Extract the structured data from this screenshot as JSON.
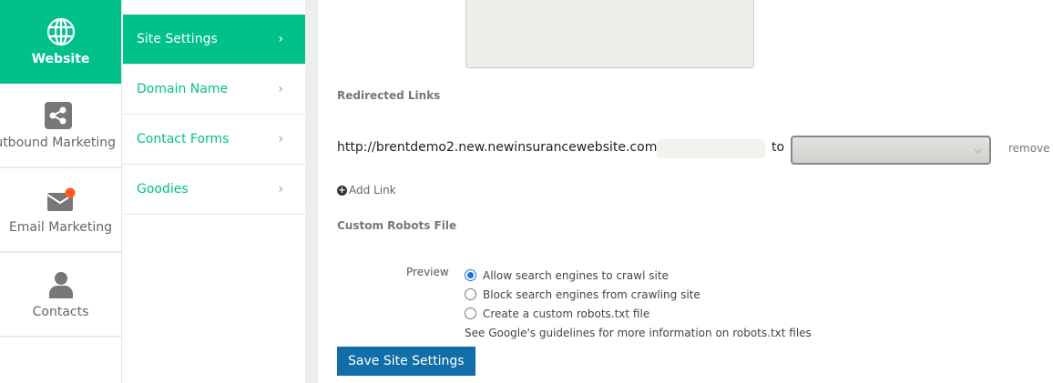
{
  "rail": [
    {
      "label": "Website",
      "icon": "globe-icon"
    },
    {
      "label": "Outbound Marketing",
      "icon": "share-icon"
    },
    {
      "label": "Email Marketing",
      "icon": "envelope-icon"
    },
    {
      "label": "Contacts",
      "icon": "user-icon"
    }
  ],
  "submenu": [
    {
      "label": "Site Settings"
    },
    {
      "label": "Domain Name"
    },
    {
      "label": "Contact Forms"
    },
    {
      "label": "Goodies"
    }
  ],
  "main": {
    "redirected_links_label": "Redirected Links",
    "url_prefix": "http://brentdemo2.new.newinsurancewebsite.com/",
    "path_value": "",
    "to_label": "to",
    "target_value": "",
    "remove_label": "remove",
    "add_link_label": "Add Link",
    "robots_label": "Custom Robots File",
    "preview_label": "Preview",
    "options": [
      {
        "label": "Allow search engines to crawl site",
        "checked": true
      },
      {
        "label": "Block search engines from crawling site",
        "checked": false
      },
      {
        "label": "Create a custom robots.txt file",
        "checked": false
      }
    ],
    "hint": "See Google's guidelines for more information on robots.txt files",
    "save_label": "Save Site Settings"
  },
  "colors": {
    "accent": "#00c08b",
    "button": "#126ea8",
    "badge": "#ff5a1f"
  }
}
